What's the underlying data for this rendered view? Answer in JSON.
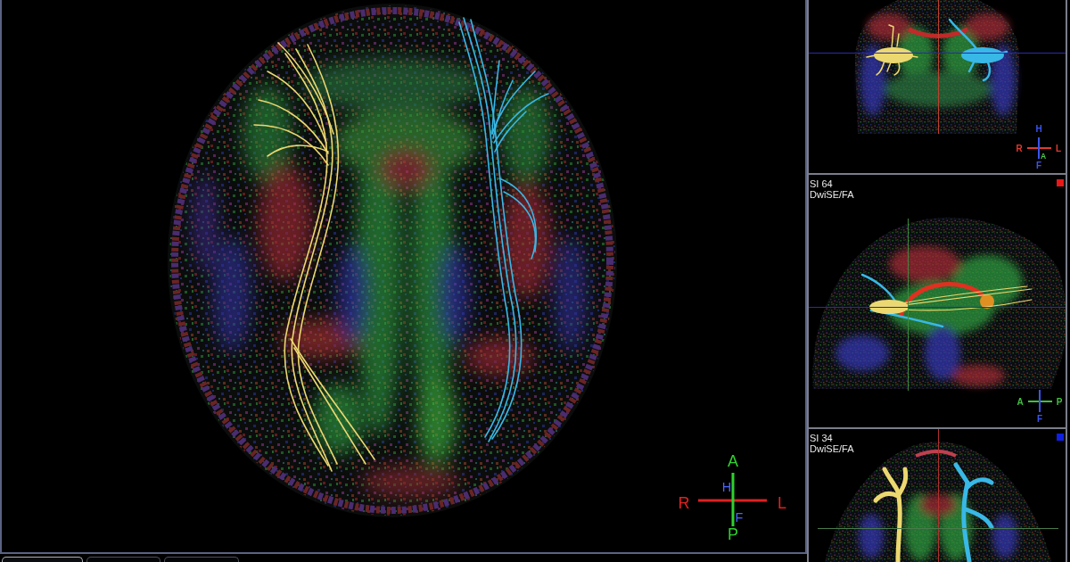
{
  "main_view": {
    "kind": "axial",
    "orientation_marker": {
      "top": {
        "text": "A",
        "color": "#30d030"
      },
      "upper": {
        "text": "H",
        "color": "#4a66ff"
      },
      "left": {
        "text": "R",
        "color": "#e02020"
      },
      "right": {
        "text": "L",
        "color": "#e02020"
      },
      "lower": {
        "text": "F",
        "color": "#4a66ff"
      },
      "bottom": {
        "text": "P",
        "color": "#30d030"
      }
    }
  },
  "tabs": [
    {
      "selected": true
    },
    {
      "selected": false
    },
    {
      "selected": false
    }
  ],
  "side_panels": [
    {
      "kind": "coronal",
      "crosshairs": {
        "vertical": {
          "color": "#c04030"
        },
        "horizontal": {
          "color": "#2a2aa8"
        }
      },
      "orientation_marker": {
        "top": {
          "text": "H",
          "color": "#3a55f0"
        },
        "left": {
          "text": "R",
          "color": "#e03a30"
        },
        "center": {
          "text": "A",
          "color": "#50c850"
        },
        "right": {
          "text": "L",
          "color": "#e03a30"
        },
        "bottom": {
          "text": "F",
          "color": "#3a55f0"
        }
      }
    },
    {
      "kind": "sagittal",
      "slice": "SI 64",
      "series": "DwiSE/FA",
      "color": "#e81818",
      "crosshairs": {
        "vertical": {
          "color": "#3c8a3c"
        },
        "horizontal": {
          "color": "#2a2aa8"
        }
      },
      "orientation_marker": {
        "left": {
          "text": "A",
          "color": "#40c040"
        },
        "right": {
          "text": "P",
          "color": "#40c040"
        },
        "bottom": {
          "text": "F",
          "color": "#3a55f0"
        }
      }
    },
    {
      "kind": "axial",
      "slice": "SI 34",
      "series": "DwiSE/FA",
      "color": "#1020e0",
      "crosshairs": {
        "vertical": {
          "color": "#b03030"
        },
        "horizontal": {
          "color": "#4a7a4a"
        }
      }
    }
  ]
}
